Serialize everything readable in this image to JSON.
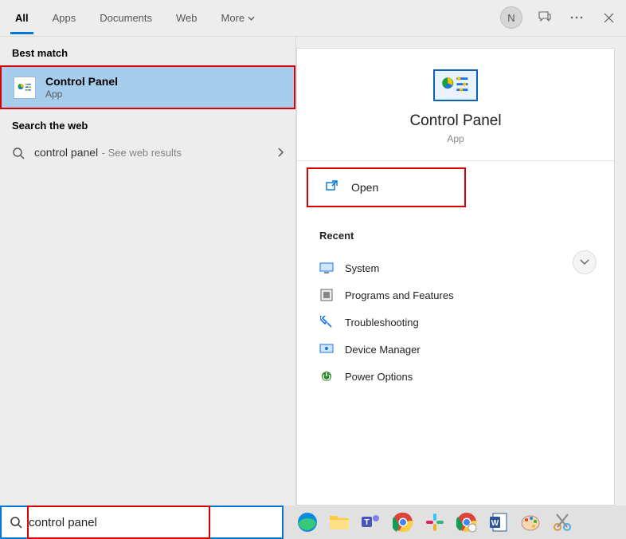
{
  "tabs": {
    "all": "All",
    "apps": "Apps",
    "documents": "Documents",
    "web": "Web",
    "more": "More"
  },
  "header_icons": {
    "user_initial": "N"
  },
  "sections": {
    "best_match": "Best match",
    "search_web": "Search the web",
    "recent": "Recent"
  },
  "best_match": {
    "title": "Control Panel",
    "subtitle": "App"
  },
  "web_result": {
    "query": "control panel",
    "suffix": "- See web results"
  },
  "details": {
    "title": "Control Panel",
    "subtitle": "App",
    "open_label": "Open"
  },
  "recent_items": [
    {
      "label": "System"
    },
    {
      "label": "Programs and Features"
    },
    {
      "label": "Troubleshooting"
    },
    {
      "label": "Device Manager"
    },
    {
      "label": "Power Options"
    }
  ],
  "search": {
    "value": "control panel"
  }
}
